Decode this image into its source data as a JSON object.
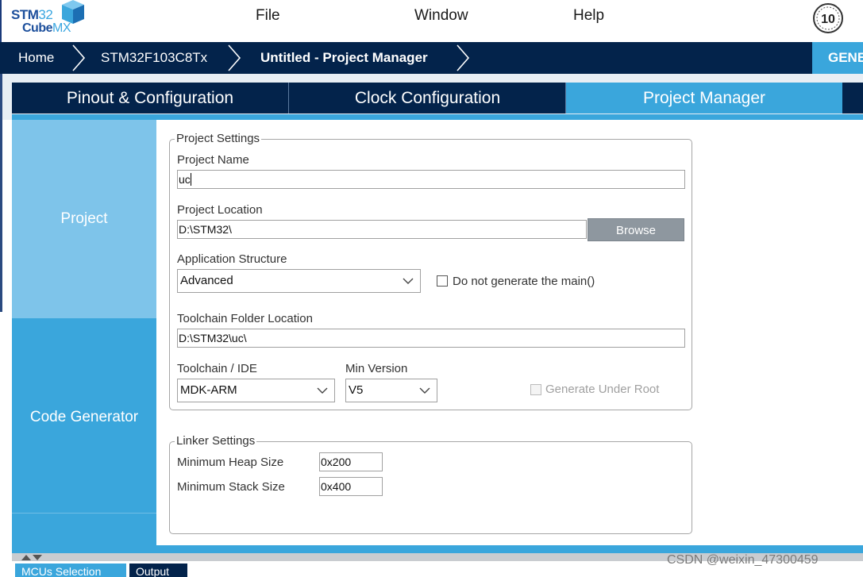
{
  "logo": {
    "line1_bold": "STM",
    "line1_thin": "32",
    "line2_bold": "Cube",
    "line2_thin": "MX"
  },
  "menu": {
    "file": "File",
    "window": "Window",
    "help": "Help"
  },
  "anniversary_badge": "10",
  "breadcrumb": {
    "home": "Home",
    "mcu": "STM32F103C8Tx",
    "project": "Untitled - Project Manager"
  },
  "generate_button": "GENERATE CODE",
  "tabs": {
    "pinout": "Pinout & Configuration",
    "clock": "Clock Configuration",
    "project_manager": "Project Manager"
  },
  "sidenav": {
    "project": "Project",
    "code_generator": "Code Generator"
  },
  "project_settings": {
    "title": "Project Settings",
    "project_name_label": "Project Name",
    "project_name_value": "uc",
    "project_location_label": "Project Location",
    "project_location_value": "D:\\STM32\\",
    "browse_label": "Browse",
    "app_structure_label": "Application Structure",
    "app_structure_value": "Advanced",
    "do_not_generate_main_label": "Do not generate the main()",
    "toolchain_folder_label": "Toolchain Folder Location",
    "toolchain_folder_value": "D:\\STM32\\uc\\",
    "toolchain_ide_label": "Toolchain / IDE",
    "toolchain_ide_value": "MDK-ARM",
    "min_version_label": "Min Version",
    "min_version_value": "V5",
    "generate_under_root_label": "Generate Under Root"
  },
  "linker_settings": {
    "title": "Linker Settings",
    "heap_label": "Minimum Heap Size",
    "heap_value": "0x200",
    "stack_label": "Minimum Stack Size",
    "stack_value": "0x400"
  },
  "bottom_tabs": {
    "mcus": "MCUs Selection",
    "output": "Output"
  },
  "watermark": "CSDN @weixin_47300459",
  "colors": {
    "navy": "#03234b",
    "accent": "#3aa6dc",
    "light_accent": "#7ec4ea",
    "button_gray": "#8e979f"
  }
}
